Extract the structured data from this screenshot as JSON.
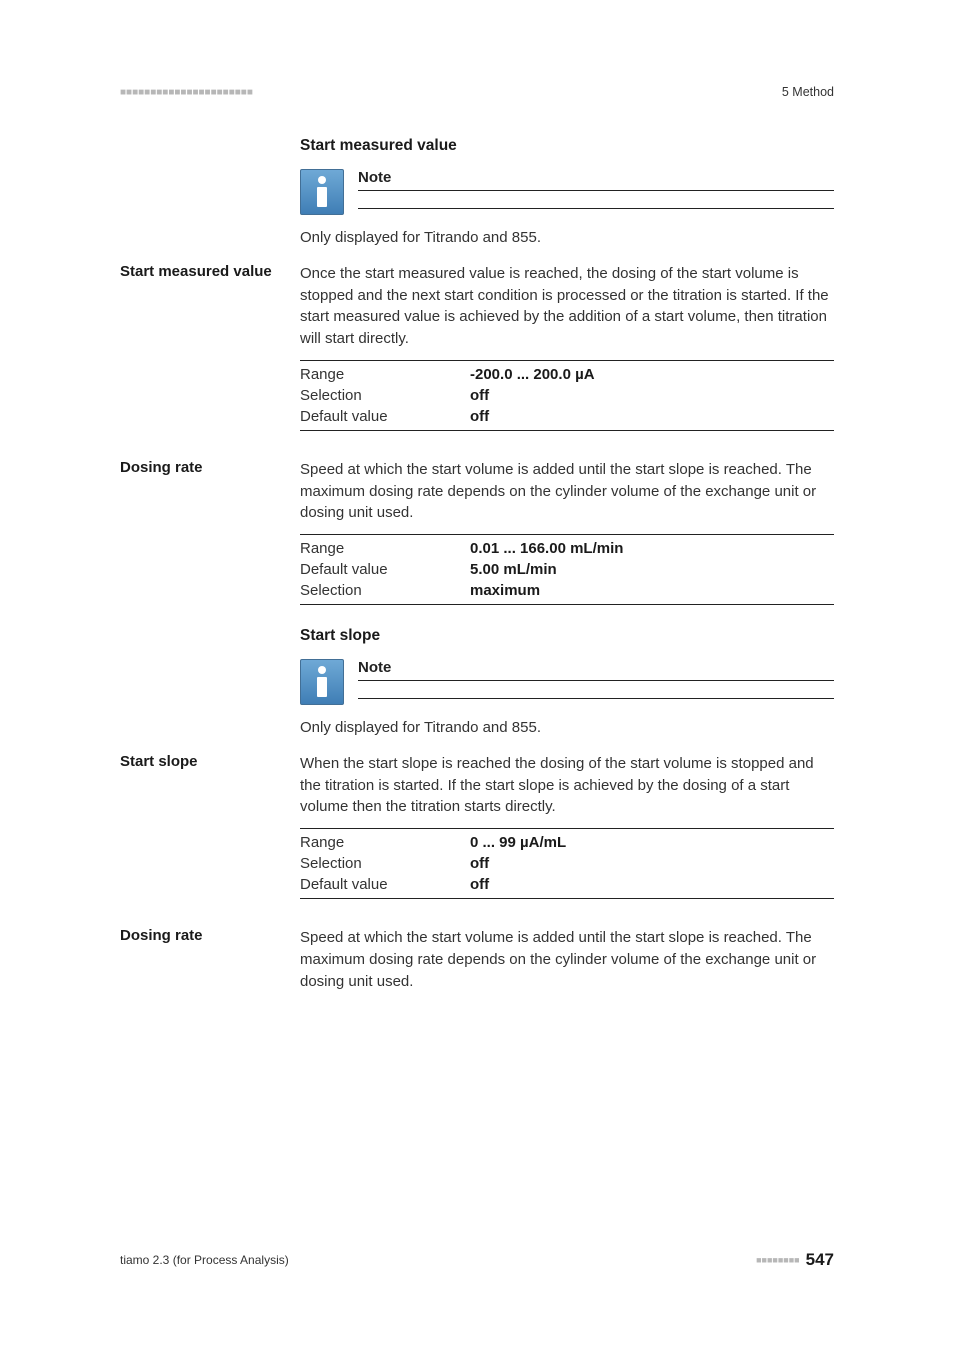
{
  "header": {
    "ticks_left": "■■■■■■■■■■■■■■■■■■■■■■",
    "section": "5 Method"
  },
  "sections": [
    {
      "heading": "Start measured value",
      "note_label": "Note",
      "note_text": "Only displayed for Titrando and 855."
    },
    {
      "param_label": "Start measured value",
      "desc": "Once the start measured value is reached, the dosing of the start volume is stopped and the next start condition is processed or the titration is started. If the start measured value is achieved by the addition of a start volume, then titration will start directly.",
      "rows": [
        {
          "k": "Range",
          "v": "-200.0 ... 200.0 µA"
        },
        {
          "k": "Selection",
          "v": "off"
        },
        {
          "k": "Default value",
          "v": "off"
        }
      ]
    },
    {
      "param_label": "Dosing rate",
      "desc": "Speed at which the start volume is added until the start slope is reached. The maximum dosing rate depends on the cylinder volume of the exchange unit or dosing unit used.",
      "rows": [
        {
          "k": "Range",
          "v": "0.01 ... 166.00 mL/min"
        },
        {
          "k": "Default value",
          "v": "5.00 mL/min"
        },
        {
          "k": "Selection",
          "v": "maximum"
        }
      ]
    },
    {
      "heading": "Start slope",
      "note_label": "Note",
      "note_text": "Only displayed for Titrando and 855."
    },
    {
      "param_label": "Start slope",
      "desc": "When the start slope is reached the dosing of the start volume is stopped and the titration is started. If the start slope is achieved by the dosing of a start volume then the titration starts directly.",
      "rows": [
        {
          "k": "Range",
          "v": "0 ... 99 µA/mL"
        },
        {
          "k": "Selection",
          "v": "off"
        },
        {
          "k": "Default value",
          "v": "off"
        }
      ]
    },
    {
      "param_label": "Dosing rate",
      "desc": "Speed at which the start volume is added until the start slope is reached. The maximum dosing rate depends on the cylinder volume of the exchange unit or dosing unit used."
    }
  ],
  "footer": {
    "left": "tiamo 2.3 (for Process Analysis)",
    "ticks": "■■■■■■■■",
    "page": "547"
  }
}
